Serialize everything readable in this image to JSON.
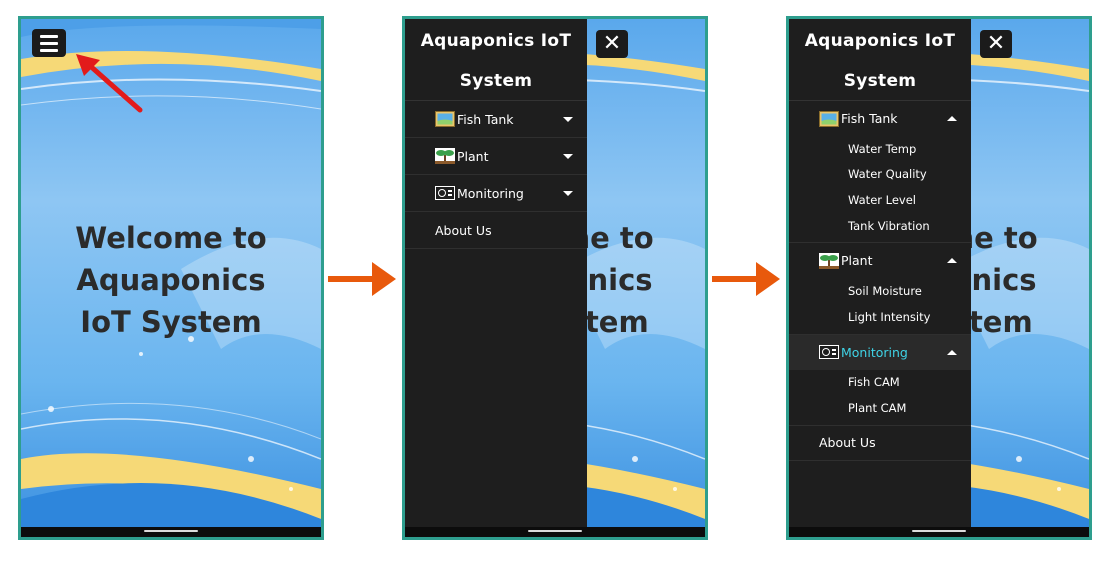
{
  "colors": {
    "frame_border": "#2e9e8e",
    "drawer_bg": "#1e1e1e",
    "active_menu_text": "#3fd3e6",
    "flow_arrow": "#e8590c",
    "pointer_arrow": "#e21b1b"
  },
  "home_screen": {
    "welcome_lines": [
      "Welcome to",
      "Aquaponics",
      "IoT System"
    ],
    "menu_icon": "hamburger-icon"
  },
  "drawer": {
    "title_lines": [
      "Aquaponics IoT",
      "System"
    ],
    "close_icon": "close-x-icon",
    "items": [
      {
        "label": "Fish Tank",
        "icon": "fish-tank-image-icon",
        "sub_items": [
          "Water Temp",
          "Water Quality",
          "Water Level",
          "Tank Vibration"
        ]
      },
      {
        "label": "Plant",
        "icon": "plant-sprout-icon",
        "sub_items": [
          "Soil Moisture",
          "Light Intensity"
        ]
      },
      {
        "label": "Monitoring",
        "icon": "camera-monitor-icon",
        "sub_items": [
          "Fish CAM",
          "Plant CAM"
        ]
      }
    ],
    "about_label": "About Us"
  },
  "flow_arrows": [
    "right-arrow-icon",
    "right-arrow-icon"
  ]
}
